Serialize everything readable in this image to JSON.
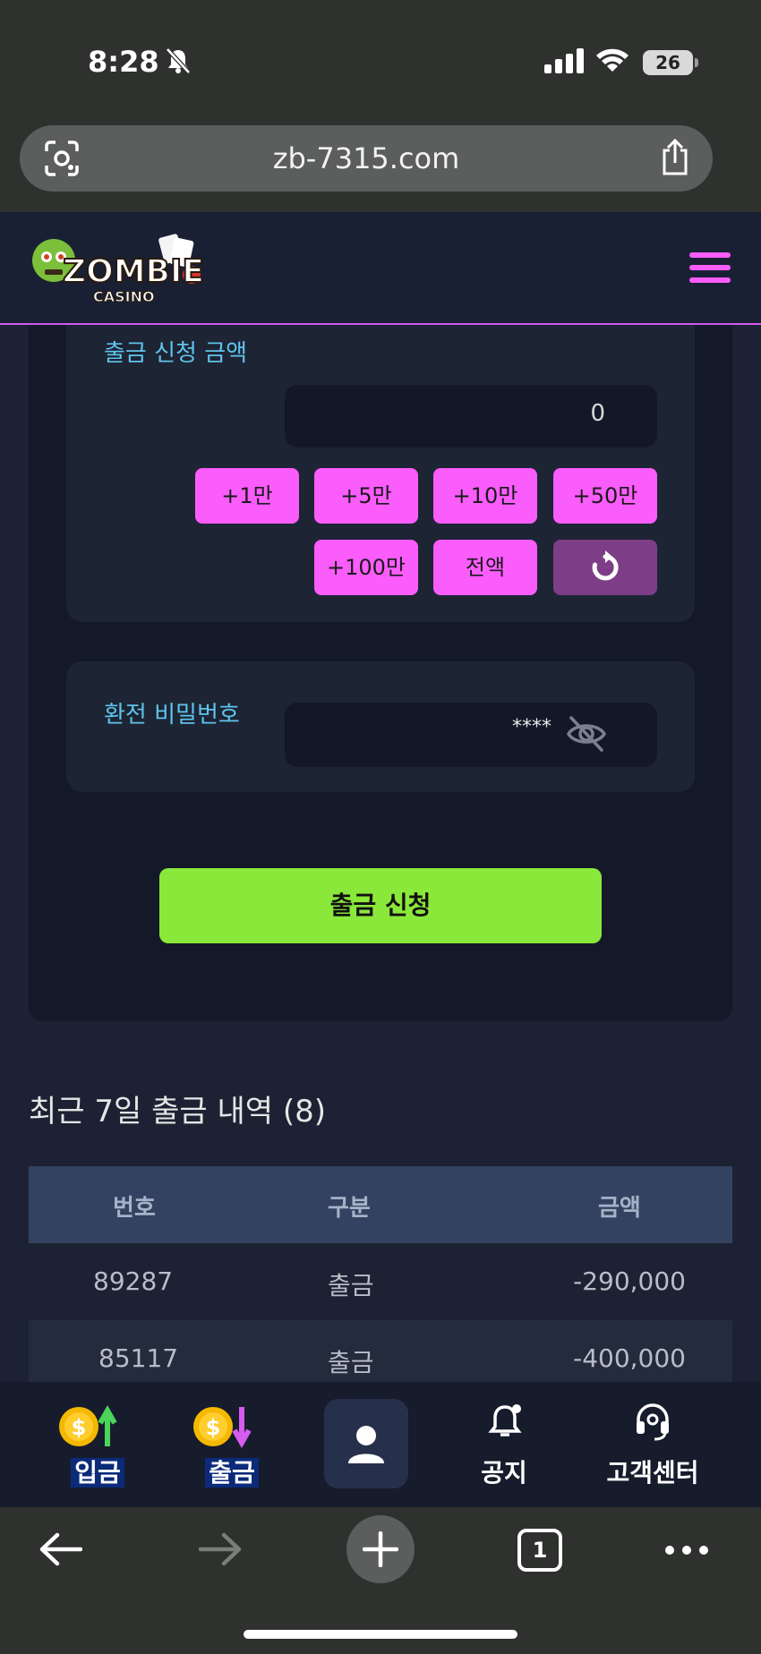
{
  "status_bar": {
    "time": "8:28",
    "battery": "26"
  },
  "browser": {
    "url": "zb-7315.com",
    "tab_count": "1"
  },
  "site": {
    "logo_text": "ZOMBIE",
    "logo_sub": "CASINO"
  },
  "withdraw_form": {
    "amount_label": "출금 신청 금액",
    "amount_value": "0",
    "chips": [
      "+1만",
      "+5만",
      "+10만",
      "+50만",
      "+100만",
      "전액"
    ],
    "password_label": "환전 비밀번호",
    "password_value": "****",
    "submit_label": "출금 신청"
  },
  "history": {
    "title": "최근 7일 출금 내역 (8)",
    "columns": [
      "번호",
      "구분",
      "금액"
    ],
    "rows": [
      {
        "id": "89287",
        "type": "출금",
        "amount": "-290,000"
      },
      {
        "id": "85117",
        "type": "출금",
        "amount": "-400,000"
      }
    ]
  },
  "bottom_nav": [
    {
      "label": "입금",
      "icon": "deposit-coin-icon"
    },
    {
      "label": "출금",
      "icon": "withdraw-coin-icon"
    },
    {
      "label": "",
      "icon": "profile-icon"
    },
    {
      "label": "공지",
      "icon": "notice-bell-icon"
    },
    {
      "label": "고객센터",
      "icon": "support-headset-icon"
    }
  ],
  "colors": {
    "accent_pink": "#fb5cfc",
    "submit_green": "#8ae83a",
    "label_blue": "#5fc4ec"
  }
}
